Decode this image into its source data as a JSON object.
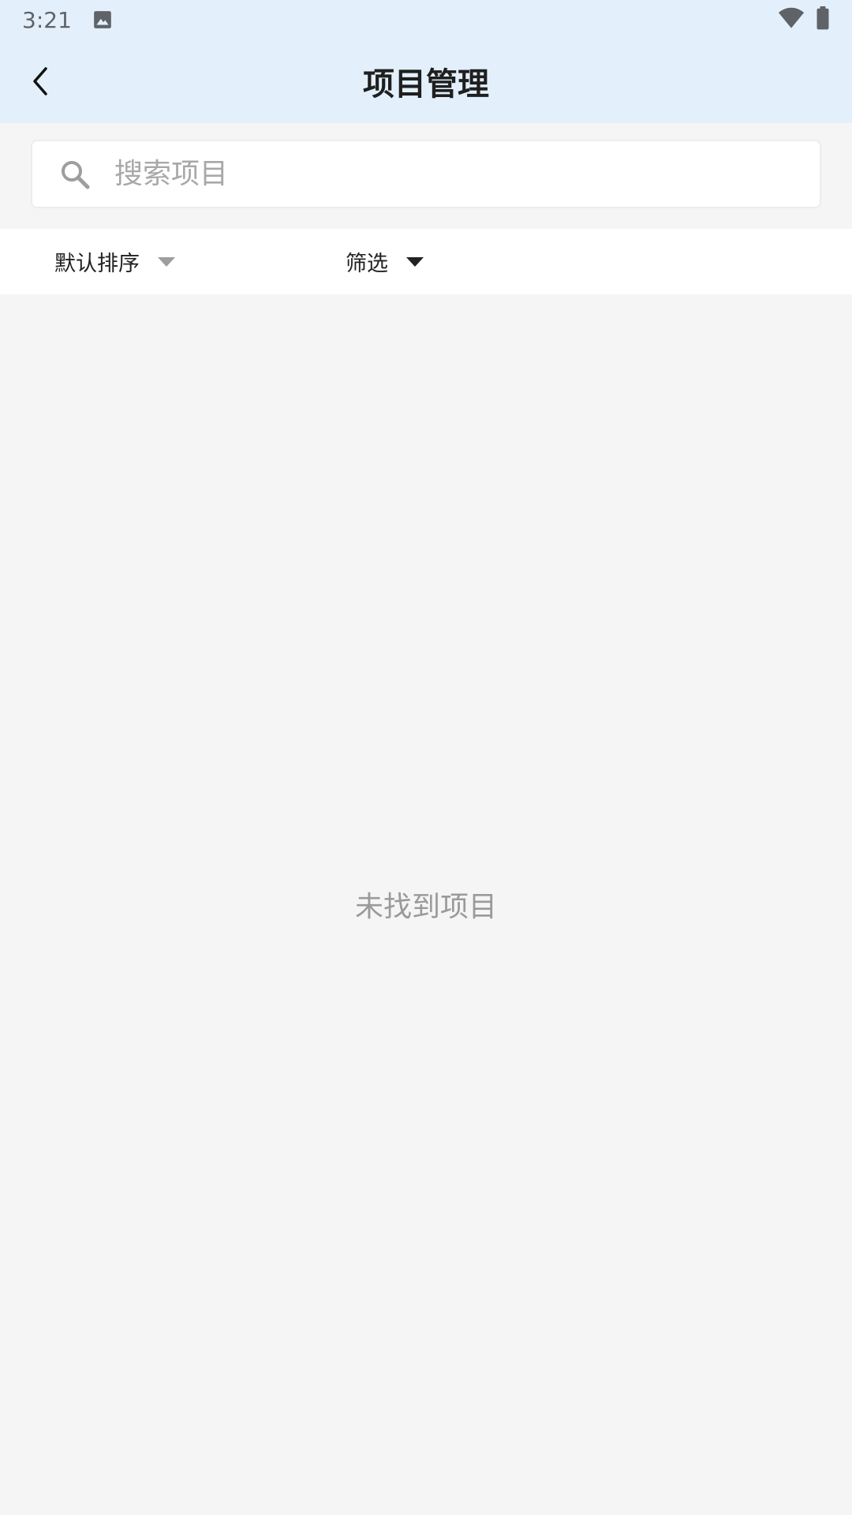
{
  "status_bar": {
    "time": "3:21",
    "icons": [
      "gallery-icon",
      "wifi-icon",
      "battery-icon"
    ]
  },
  "app_bar": {
    "title": "项目管理",
    "back_icon": "chevron-left-icon",
    "background": "#e3f0fb"
  },
  "search": {
    "placeholder": "搜索项目",
    "value": "",
    "icon": "search-icon"
  },
  "filters": {
    "sort_label": "默认排序",
    "sort_arrow_color": "#9e9e9e",
    "filter_label": "筛选",
    "filter_arrow_color": "#222222"
  },
  "empty_state": {
    "message": "未找到项目"
  }
}
